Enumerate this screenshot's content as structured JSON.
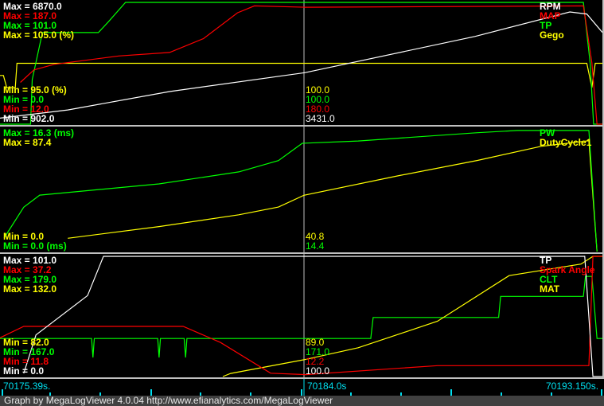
{
  "colors": {
    "white": "#ffffff",
    "red": "#ff0000",
    "green": "#00ff00",
    "yellow": "#ffff00",
    "cursor": "#00e0f0",
    "grid": "#c0c0c0"
  },
  "time_axis": {
    "start": 70175.39,
    "end": 70193.15,
    "cursor": 70184.0,
    "start_label": "70175.39s.",
    "cursor_label": "70184.0s",
    "end_label": "70193.150s."
  },
  "footer": "Graph by MegaLogViewer 4.0.04 http://www.efianalytics.com/MegaLogViewer",
  "panels": [
    {
      "max_labels": [
        {
          "text": "Max = 6870.0",
          "color": "#ffffff"
        },
        {
          "text": "Max = 187.0",
          "color": "#ff0000"
        },
        {
          "text": "Max = 101.0",
          "color": "#00ff00"
        },
        {
          "text": "Max = 105.0 (%)",
          "color": "#ffff00"
        }
      ],
      "min_labels": [
        {
          "text": "Min = 95.0 (%)",
          "color": "#ffff00"
        },
        {
          "text": "Min = 0.0",
          "color": "#00ff00"
        },
        {
          "text": "Min = 12.0",
          "color": "#ff0000"
        },
        {
          "text": "Min = 902.0",
          "color": "#ffffff"
        }
      ],
      "names": [
        {
          "text": "RPM",
          "color": "#ffffff"
        },
        {
          "text": "MAP",
          "color": "#ff0000"
        },
        {
          "text": "TP",
          "color": "#00ff00"
        },
        {
          "text": "Gego",
          "color": "#ffff00"
        }
      ],
      "cursor_values": [
        {
          "text": "100.0",
          "color": "#ffff00"
        },
        {
          "text": "100.0",
          "color": "#00ff00"
        },
        {
          "text": "180.0",
          "color": "#ff0000"
        },
        {
          "text": "3431.0",
          "color": "#ffffff"
        }
      ],
      "traces": [
        {
          "name": "Gego",
          "color": "#ffff00",
          "min": 95,
          "max": 105,
          "pts": [
            [
              0,
              99
            ],
            [
              0.1,
              99
            ],
            [
              0.2,
              98
            ],
            [
              0.45,
              98
            ],
            [
              0.5,
              100
            ],
            [
              17.3,
              100
            ],
            [
              17.45,
              98
            ],
            [
              17.55,
              100
            ],
            [
              17.76,
              100
            ]
          ]
        },
        {
          "name": "TP",
          "color": "#00ff00",
          "min": 0,
          "max": 101,
          "pts": [
            [
              0,
              0
            ],
            [
              0.9,
              0
            ],
            [
              0.95,
              37
            ],
            [
              1.25,
              76
            ],
            [
              2.9,
              76
            ],
            [
              3.2,
              85
            ],
            [
              3.7,
              101
            ],
            [
              17.2,
              101
            ],
            [
              17.4,
              50
            ],
            [
              17.5,
              0
            ],
            [
              17.76,
              0
            ]
          ]
        },
        {
          "name": "MAP",
          "color": "#ff0000",
          "min": 12,
          "max": 187,
          "pts": [
            [
              0.6,
              72
            ],
            [
              1.0,
              90
            ],
            [
              1.6,
              98
            ],
            [
              3.5,
              110
            ],
            [
              5,
              115
            ],
            [
              6,
              135
            ],
            [
              7,
              172
            ],
            [
              7.5,
              182
            ],
            [
              9,
              180
            ],
            [
              17.2,
              182
            ],
            [
              17.45,
              100
            ],
            [
              17.6,
              12
            ],
            [
              17.76,
              12
            ]
          ]
        },
        {
          "name": "RPM",
          "color": "#ffffff",
          "min": 902,
          "max": 6870,
          "pts": [
            [
              0,
              1200
            ],
            [
              2.0,
              1600
            ],
            [
              5,
              2500
            ],
            [
              9,
              3431
            ],
            [
              14,
              5200
            ],
            [
              16.8,
              6400
            ],
            [
              17.3,
              6300
            ],
            [
              17.76,
              5400
            ]
          ]
        }
      ]
    },
    {
      "max_labels": [
        {
          "text": "Max = 16.3 (ms)",
          "color": "#00ff00"
        },
        {
          "text": "Max = 87.4",
          "color": "#ffff00"
        }
      ],
      "min_labels": [
        {
          "text": "Min = 0.0",
          "color": "#ffff00"
        },
        {
          "text": "Min = 0.0 (ms)",
          "color": "#00ff00"
        }
      ],
      "names": [
        {
          "text": "PW",
          "color": "#00ff00"
        },
        {
          "text": "DutyCycle1",
          "color": "#ffff00"
        }
      ],
      "cursor_values": [
        {
          "text": "40.8",
          "color": "#ffff00"
        },
        {
          "text": "14.4",
          "color": "#00ff00"
        }
      ],
      "traces": [
        {
          "name": "DutyCycle1",
          "color": "#ffff00",
          "min": 0,
          "max": 87.4,
          "pts": [
            [
              2.0,
              9.5
            ],
            [
              4.69,
              17.8
            ],
            [
              7.04,
              26.2
            ],
            [
              8.21,
              31.7
            ],
            [
              8.96,
              40.1
            ],
            [
              11.73,
              54
            ],
            [
              14.08,
              65
            ],
            [
              15.95,
              75
            ],
            [
              17.36,
              79
            ],
            [
              17.6,
              0
            ]
          ]
        },
        {
          "name": "PW",
          "color": "#00ff00",
          "min": 0,
          "max": 16.3,
          "pts": [
            [
              0.12,
              1.8
            ],
            [
              0.7,
              5.9
            ],
            [
              1.17,
              7.5
            ],
            [
              2.35,
              8.0
            ],
            [
              4.69,
              9.0
            ],
            [
              7.04,
              10.6
            ],
            [
              8.21,
              12.1
            ],
            [
              8.91,
              14.4
            ],
            [
              10.56,
              14.7
            ],
            [
              14.08,
              15.8
            ],
            [
              15.25,
              16.1
            ],
            [
              17.36,
              16.1
            ],
            [
              17.6,
              0
            ]
          ]
        }
      ]
    },
    {
      "max_labels": [
        {
          "text": "Max = 101.0",
          "color": "#ffffff"
        },
        {
          "text": "Max = 37.2",
          "color": "#ff0000"
        },
        {
          "text": "Max = 179.0",
          "color": "#00ff00"
        },
        {
          "text": "Max = 132.0",
          "color": "#ffff00"
        }
      ],
      "min_labels": [
        {
          "text": "Min = 82.0",
          "color": "#ffff00"
        },
        {
          "text": "Min = 167.0",
          "color": "#00ff00"
        },
        {
          "text": "Min = 11.8",
          "color": "#ff0000"
        },
        {
          "text": "Min = 0.0",
          "color": "#ffffff"
        }
      ],
      "names": [
        {
          "text": "TP",
          "color": "#ffffff"
        },
        {
          "text": "Spark Angle",
          "color": "#ff0000"
        },
        {
          "text": "CLT",
          "color": "#00ff00"
        },
        {
          "text": "MAT",
          "color": "#ffff00"
        }
      ],
      "cursor_values": [
        {
          "text": "89.0",
          "color": "#ffff00"
        },
        {
          "text": "171.0",
          "color": "#00ff00"
        },
        {
          "text": "12.2",
          "color": "#ff0000"
        },
        {
          "text": "100.0",
          "color": "#ffffff"
        }
      ],
      "traces": [
        {
          "name": "CLT",
          "color": "#00ff00",
          "min": 167,
          "max": 179,
          "pts": [
            [
              0,
              170.8
            ],
            [
              2.7,
              170.8
            ],
            [
              2.74,
              168.9
            ],
            [
              2.78,
              170.8
            ],
            [
              4.65,
              170.8
            ],
            [
              4.69,
              168.9
            ],
            [
              4.73,
              170.8
            ],
            [
              5.43,
              170.8
            ],
            [
              5.47,
              168.9
            ],
            [
              5.51,
              170.8
            ],
            [
              10.93,
              170.8
            ],
            [
              11.0,
              172.9
            ],
            [
              14.7,
              172.9
            ],
            [
              14.76,
              175
            ],
            [
              17.2,
              175
            ],
            [
              17.26,
              177
            ],
            [
              17.45,
              177
            ],
            [
              17.6,
              170.8
            ],
            [
              17.76,
              170.8
            ]
          ]
        },
        {
          "name": "MAT",
          "color": "#ffff00",
          "min": 82,
          "max": 132,
          "pts": [
            [
              6.57,
              82
            ],
            [
              6.8,
              83.3
            ],
            [
              8.96,
              89
            ],
            [
              10.56,
              94
            ],
            [
              12.9,
              105
            ],
            [
              15.01,
              124
            ],
            [
              17.13,
              128.8
            ],
            [
              17.48,
              132
            ],
            [
              17.76,
              132
            ]
          ]
        },
        {
          "name": "Spark Angle",
          "color": "#ff0000",
          "min": 11.8,
          "max": 37.2,
          "pts": [
            [
              0,
              20
            ],
            [
              0.7,
              22.4
            ],
            [
              5.4,
              22.4
            ],
            [
              6.5,
              19
            ],
            [
              7.98,
              12.5
            ],
            [
              9,
              12.2
            ],
            [
              12.9,
              14.1
            ],
            [
              17.36,
              14.1
            ],
            [
              17.48,
              37.2
            ],
            [
              17.76,
              37.2
            ]
          ]
        },
        {
          "name": "TP",
          "color": "#ffffff",
          "min": 0,
          "max": 101,
          "pts": [
            [
              0.7,
              2.6
            ],
            [
              1.06,
              35
            ],
            [
              2.58,
              68
            ],
            [
              3.05,
              101
            ],
            [
              17.24,
              101
            ],
            [
              17.48,
              0
            ],
            [
              17.76,
              0
            ]
          ]
        }
      ]
    }
  ]
}
